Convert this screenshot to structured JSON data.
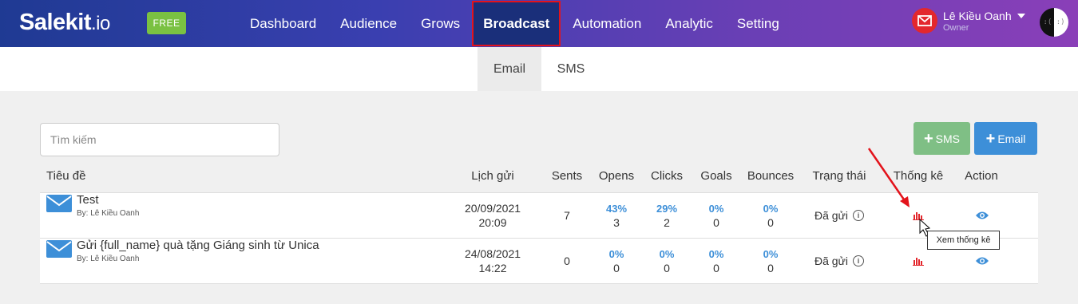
{
  "brand": {
    "name": "Salekit",
    "suffix": ".io",
    "plan_badge": "FREE"
  },
  "nav": {
    "items": [
      {
        "label": "Dashboard"
      },
      {
        "label": "Audience"
      },
      {
        "label": "Grows"
      },
      {
        "label": "Broadcast",
        "active": true
      },
      {
        "label": "Automation"
      },
      {
        "label": "Analytic"
      },
      {
        "label": "Setting"
      }
    ]
  },
  "user": {
    "name": "Lê Kiều Oanh",
    "role": "Owner"
  },
  "subtabs": {
    "email": "Email",
    "sms": "SMS"
  },
  "search": {
    "placeholder": "Tìm kiếm"
  },
  "buttons": {
    "sms": "SMS",
    "email": "Email"
  },
  "table": {
    "headers": {
      "title": "Tiêu đề",
      "schedule": "Lịch gửi",
      "sents": "Sents",
      "opens": "Opens",
      "clicks": "Clicks",
      "goals": "Goals",
      "bounces": "Bounces",
      "status": "Trạng thái",
      "stats": "Thống kê",
      "action": "Action"
    },
    "rows": [
      {
        "title": "Test",
        "by": "By: Lê Kiều Oanh",
        "date": "20/09/2021",
        "time": "20:09",
        "sents": "7",
        "opens_pct": "43%",
        "opens": "3",
        "clicks_pct": "29%",
        "clicks": "2",
        "goals_pct": "0%",
        "goals": "0",
        "bounces_pct": "0%",
        "bounces": "0",
        "status": "Đã gửi"
      },
      {
        "title": "Gửi {full_name} quà tặng Giáng sinh từ Unica",
        "by": "By: Lê Kiều Oanh",
        "date": "24/08/2021",
        "time": "14:22",
        "sents": "0",
        "opens_pct": "0%",
        "opens": "0",
        "clicks_pct": "0%",
        "clicks": "0",
        "goals_pct": "0%",
        "goals": "0",
        "bounces_pct": "0%",
        "bounces": "0",
        "status": "Đã gửi"
      }
    ]
  },
  "tooltip": "Xem thống kê",
  "colors": {
    "accent": "#3d8fd8",
    "stats_icon": "#e3272d",
    "sms_button": "#7fbf85",
    "highlight": "#e3131b"
  }
}
